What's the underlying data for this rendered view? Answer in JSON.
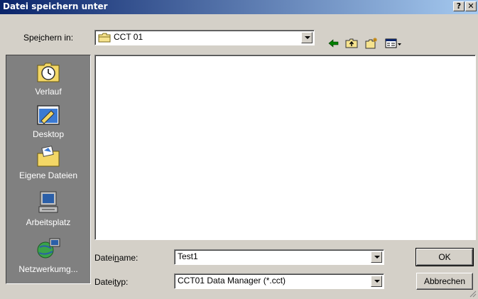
{
  "window": {
    "title": "Datei speichern unter",
    "help_label": "?",
    "close_label": "✕"
  },
  "location": {
    "label_prefix": "Spe",
    "label_hot": "i",
    "label_suffix": "chern in:",
    "folder": "CCT 01"
  },
  "toolbar": {
    "back_icon": "back-arrow-icon",
    "up_icon": "up-folder-icon",
    "new_folder_icon": "new-folder-icon",
    "view_icon": "view-menu-icon"
  },
  "places": [
    {
      "label": "Verlauf",
      "icon": "history-icon"
    },
    {
      "label": "Desktop",
      "icon": "desktop-icon"
    },
    {
      "label": "Eigene Dateien",
      "icon": "my-documents-icon"
    },
    {
      "label": "Arbeitsplatz",
      "icon": "my-computer-icon"
    },
    {
      "label": "Netzwerkumg...",
      "icon": "network-icon"
    }
  ],
  "filename": {
    "label_prefix": "Datei",
    "label_hot": "n",
    "label_suffix": "ame:",
    "value": "Test1"
  },
  "filetype": {
    "label_prefix": "Datei",
    "label_hot": "t",
    "label_suffix": "yp:",
    "value": "CCT01 Data Manager (*.cct)"
  },
  "buttons": {
    "ok": "OK",
    "cancel": "Abbrechen"
  }
}
